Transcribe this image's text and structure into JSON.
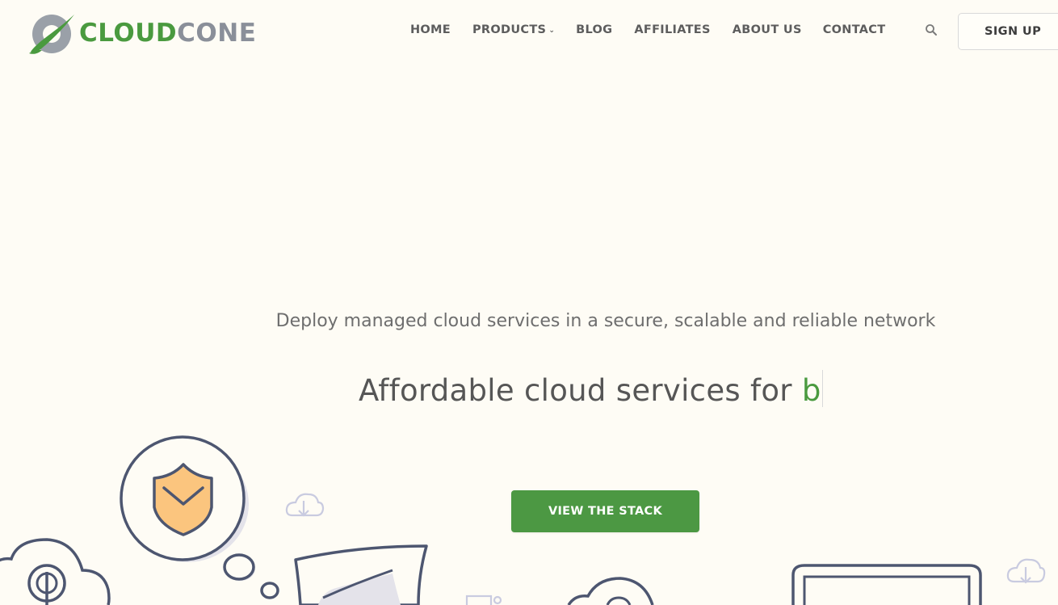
{
  "brand": {
    "logo_cloud": "CLOUD",
    "logo_cone": "CONE",
    "green": "#4a9a3f",
    "gray": "#8a8f99"
  },
  "nav": {
    "items": [
      {
        "label": "HOME"
      },
      {
        "label": "PRODUCTS",
        "has_dropdown": true
      },
      {
        "label": "BLOG"
      },
      {
        "label": "AFFILIATES"
      },
      {
        "label": "ABOUT US"
      },
      {
        "label": "CONTACT"
      }
    ],
    "search_icon": "search-icon",
    "signup_label": "SIGN UP"
  },
  "hero": {
    "tagline": "Deploy managed cloud services in a secure, scalable and reliable network",
    "headline_static": "Affordable cloud services for",
    "headline_typed": "b",
    "cta_label": "VIEW THE STACK",
    "cta_color": "#4c9843",
    "background": "#fefcf5"
  },
  "illustrations": [
    "shield-bubble-icon",
    "cloud-download-icon",
    "cloud-power-icon",
    "document-icon",
    "monitor-icon"
  ]
}
